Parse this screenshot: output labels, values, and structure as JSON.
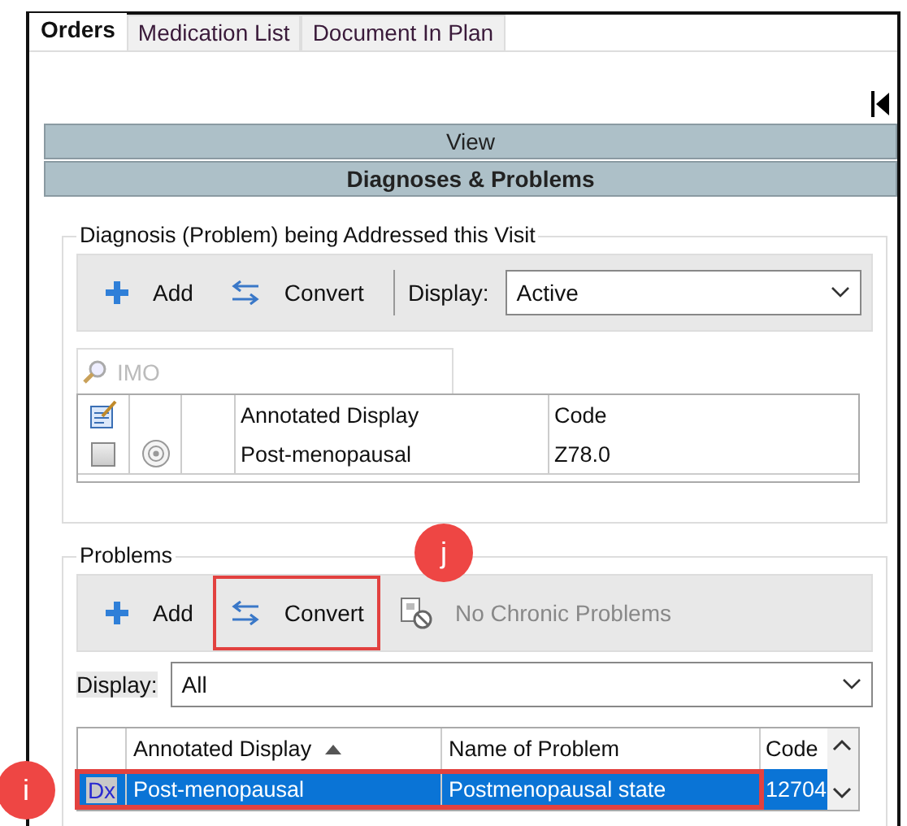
{
  "tabs": [
    {
      "label": "Orders",
      "selected": true
    },
    {
      "label": "Medication List",
      "selected": false
    },
    {
      "label": "Document In Plan",
      "selected": false
    }
  ],
  "view_header": "View",
  "section_header": "Diagnoses & Problems",
  "diagnosis_group": {
    "title": "Diagnosis (Problem) being Addressed this Visit",
    "toolbar": {
      "add": "Add",
      "convert": "Convert",
      "display_label": "Display:",
      "display_value": "Active"
    },
    "search": {
      "placeholder": "IMO"
    },
    "table": {
      "columns": [
        "Annotated Display",
        "Code"
      ],
      "rows": [
        {
          "checked": false,
          "annotated_display": "Post-menopausal",
          "code": "Z78.0"
        }
      ]
    }
  },
  "problems_group": {
    "title": "Problems",
    "toolbar": {
      "add": "Add",
      "convert": "Convert",
      "convert_highlighted": true,
      "chronic": "No Chronic Problems",
      "chronic_disabled": true
    },
    "display_label": "Display:",
    "display_value": "All",
    "table": {
      "columns": [
        {
          "label": "Annotated Display",
          "sorted": true
        },
        {
          "label": "Name of Problem",
          "sorted": false
        },
        {
          "label": "Code",
          "sorted": false
        }
      ],
      "rows": [
        {
          "selected": true,
          "highlighted": true,
          "type": "Dx",
          "annotated_display": "Post-menopausal",
          "name": "Postmenopausal state",
          "code": "12704"
        }
      ]
    }
  },
  "callouts": [
    {
      "label": "i"
    },
    {
      "label": "j"
    }
  ]
}
